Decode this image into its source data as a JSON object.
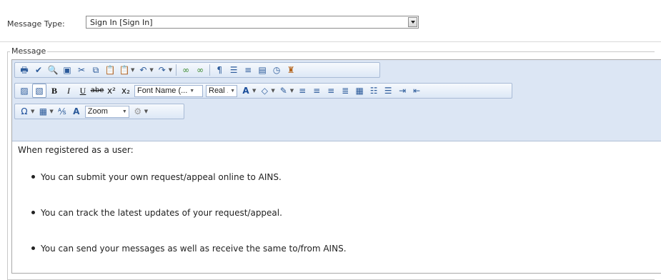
{
  "header": {
    "message_type_label": "Message Type:",
    "message_type_value": "Sign In [Sign In]"
  },
  "message_box": {
    "legend": "Message"
  },
  "toolbar": {
    "row1": [
      "print-icon",
      "spellcheck-icon",
      "find-icon",
      "select-all-icon",
      "cut-icon",
      "copy-icon",
      "paste-icon",
      "paste-options-icon",
      "undo-icon",
      "redo-icon",
      "hyperlink-icon",
      "remove-link-icon",
      "paragraph-icon",
      "insert-paragraph-icon",
      "align-icon",
      "form-element-icon",
      "insert-date-icon",
      "format-painter-icon"
    ],
    "font_name": "Font Name (...",
    "font_size": "Real ...",
    "zoom": "Zoom"
  },
  "content": {
    "intro": "When registered as a user:",
    "bullets": [
      "You can submit your own request/appeal online to AINS.",
      "You can track the latest updates of your request/appeal.",
      "You can send your messages as well as receive the same to/from AINS."
    ]
  }
}
